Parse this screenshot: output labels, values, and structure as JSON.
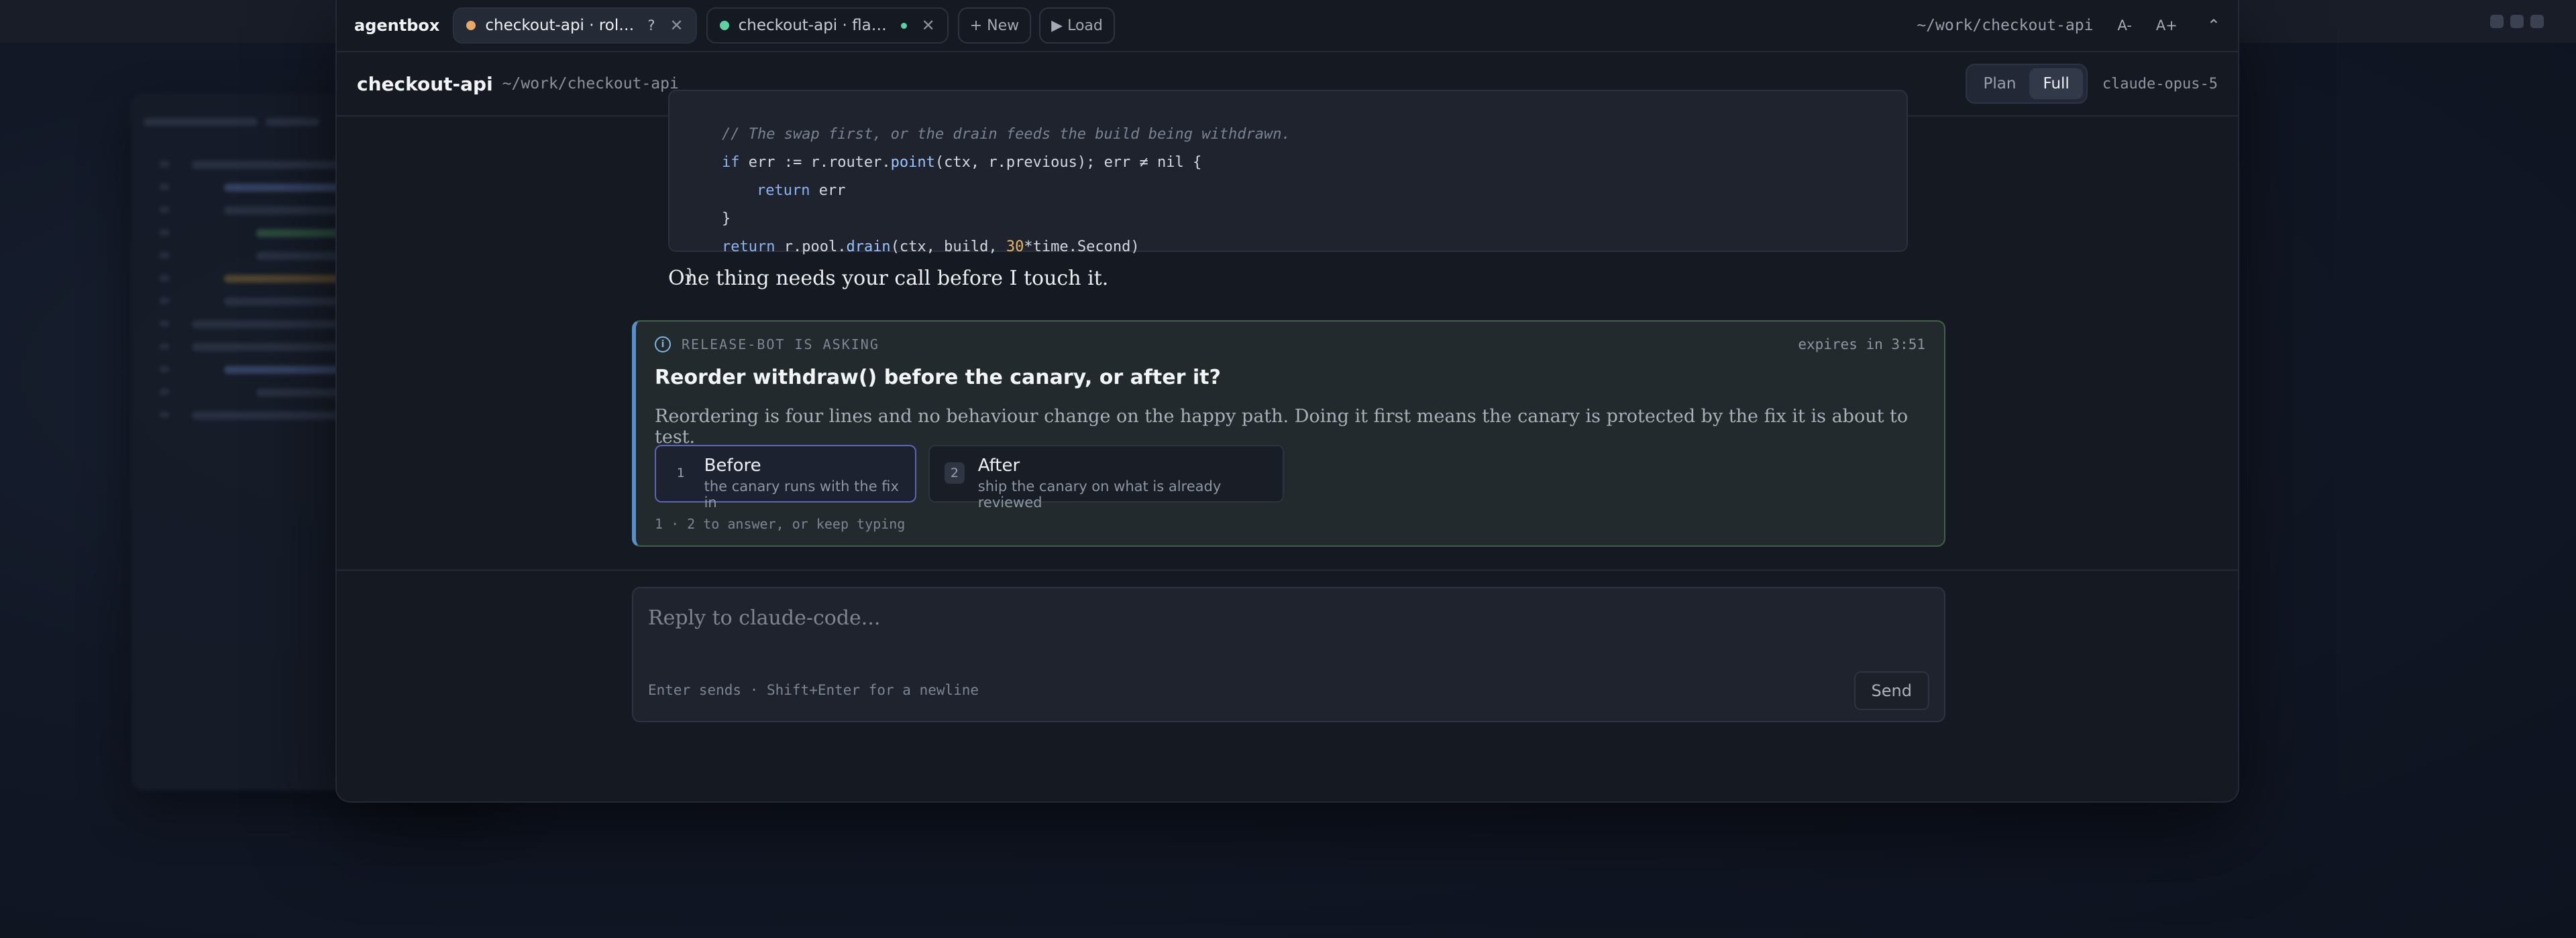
{
  "app": {
    "brand": "agentbox",
    "tabs": [
      {
        "title": "checkout-api · rollb…",
        "badge": "?",
        "dot_color": "#e8a86a",
        "active": true
      },
      {
        "title": "checkout-api · flaky …",
        "dot_color": "#5fd0a0",
        "active": false
      }
    ],
    "new_label": "+ New",
    "load_label": "▶ Load",
    "cwd": "~/work/checkout-api",
    "font_smaller": "A-",
    "font_larger": "A+",
    "collapse_icon": "chevron-up-icon"
  },
  "header": {
    "project": "checkout-api",
    "path": "~/work/checkout-api",
    "modes": [
      "Plan",
      "Full"
    ],
    "active_mode": "Full",
    "model": "claude-opus-5"
  },
  "code": {
    "comment": "// The swap first, or the drain feeds the build being withdrawn."
  },
  "message": {
    "prose": "One thing needs your call before I touch it."
  },
  "ask": {
    "label": "RELEASE-BOT IS ASKING",
    "expires": "expires in 3:51",
    "question": "Reorder withdraw() before the canary, or after it?",
    "description": "Reordering is four lines and no behaviour change on the happy path. Doing it first means the canary is protected by the fix it is about to test.",
    "options": [
      {
        "num": "1",
        "title": "Before",
        "sub": "the canary runs with the fix in"
      },
      {
        "num": "2",
        "title": "After",
        "sub": "ship the canary on what is already reviewed"
      }
    ],
    "hint": "1 · 2 to answer, or keep typing"
  },
  "reply": {
    "placeholder": "Reply to claude-code...",
    "hint": "Enter sends · Shift+Enter for a newline",
    "send_label": "Send"
  },
  "colors": {
    "accent_border": "#41614a",
    "accent_left": "#5b8fc7",
    "selected_option": "#5d66b4"
  }
}
